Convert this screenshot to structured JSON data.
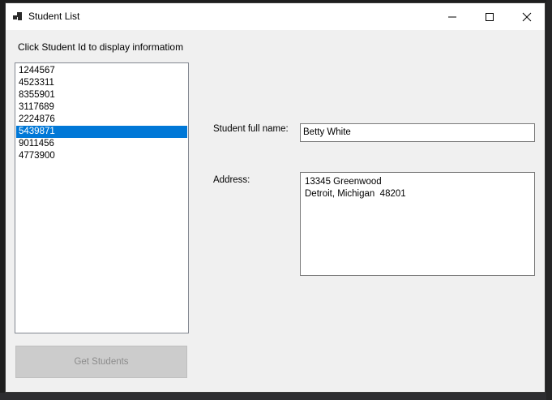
{
  "window": {
    "title": "Student List"
  },
  "main": {
    "prompt": "Click Student Id to display informatiom",
    "student_ids": [
      "1244567",
      "4523311",
      "8355901",
      "3117689",
      "2224876",
      "5439871",
      "9011456",
      "4773900"
    ],
    "selected_index": 5,
    "name_label": "Student full name:",
    "name_value": "Betty White",
    "address_label": "Address:",
    "address_lines": [
      "13345 Greenwood",
      "Detroit, Michigan  48201"
    ],
    "get_students_label": "Get Students"
  },
  "colors": {
    "selection": "#0078d7",
    "window_bg": "#f0f0f0"
  }
}
